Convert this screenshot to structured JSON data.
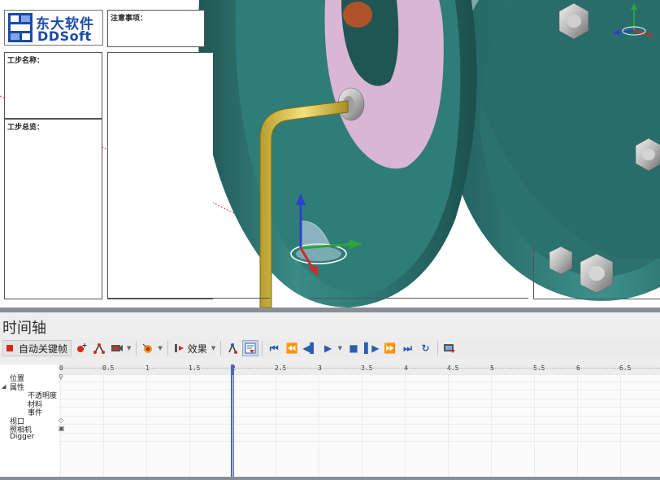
{
  "app": {
    "logo": {
      "brand_cn": "东大软件",
      "brand_en": "DDSoft"
    }
  },
  "sheet": {
    "notes_label": "注意事项：",
    "step_name_label": "工步名称：",
    "step_overview_label": "工步总览："
  },
  "timeline": {
    "title": "时间轴",
    "toolbar": {
      "autokey_label": "自动关键帧",
      "effects_label": "效果",
      "icons": [
        "add-position-key-icon",
        "add-rotation-key-icon",
        "add-camera-key-icon",
        "add-attribute-key-icon",
        "insert-effect-icon",
        "show-track-icon",
        "filter-track-icon",
        "go-to-start-icon",
        "prev-key-icon",
        "step-back-icon",
        "play-icon",
        "stop-icon",
        "step-forward-icon",
        "next-key-icon",
        "go-to-end-icon",
        "loop-icon",
        "export-video-icon"
      ]
    },
    "ruler": {
      "ticks": [
        "0",
        "0.5",
        "1",
        "1.5",
        "2",
        "2.5",
        "3",
        "3.5",
        "4",
        "4.5",
        "5",
        "5.5",
        "6",
        "6.5"
      ],
      "playhead_time": 2
    },
    "tracks": [
      {
        "label": "位置",
        "indent": 0,
        "marker": "pin"
      },
      {
        "label": "属性",
        "indent": 0,
        "collapsible": true
      },
      {
        "label": "不透明度",
        "indent": 2
      },
      {
        "label": "材料",
        "indent": 2
      },
      {
        "label": "事件",
        "indent": 2
      },
      {
        "label": "视口",
        "indent": 0,
        "marker": "diamond"
      },
      {
        "label": "照相机",
        "indent": 0,
        "marker": "camera"
      },
      {
        "label": "Digger",
        "indent": 0
      }
    ]
  },
  "colors": {
    "flange": "#2f7b78",
    "flange_dark": "#1f5653",
    "gasket": "#d9b6d4",
    "wrench": "#e6cf5a",
    "timeline_bg": "#eeeeee",
    "playhead": "#4d68b8",
    "autokey_red": "#d42a1a",
    "brand_blue": "#1b4aa8"
  }
}
